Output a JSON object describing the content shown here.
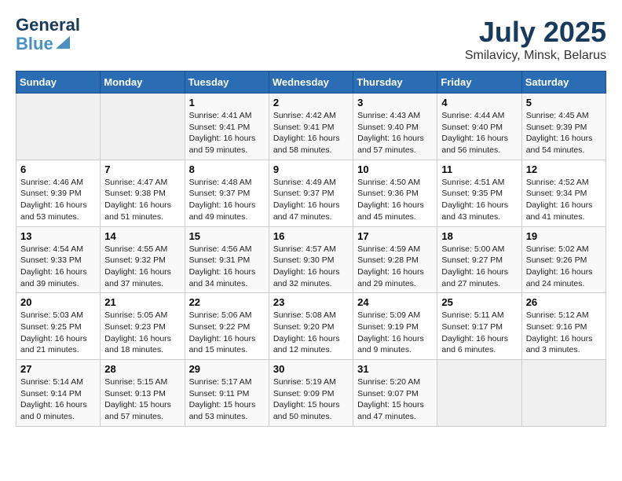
{
  "logo": {
    "line1": "General",
    "line2": "Blue"
  },
  "title": "July 2025",
  "subtitle": "Smilavicy, Minsk, Belarus",
  "weekdays": [
    "Sunday",
    "Monday",
    "Tuesday",
    "Wednesday",
    "Thursday",
    "Friday",
    "Saturday"
  ],
  "weeks": [
    [
      {
        "day": "",
        "info": ""
      },
      {
        "day": "",
        "info": ""
      },
      {
        "day": "1",
        "info": "Sunrise: 4:41 AM\nSunset: 9:41 PM\nDaylight: 16 hours and 59 minutes."
      },
      {
        "day": "2",
        "info": "Sunrise: 4:42 AM\nSunset: 9:41 PM\nDaylight: 16 hours and 58 minutes."
      },
      {
        "day": "3",
        "info": "Sunrise: 4:43 AM\nSunset: 9:40 PM\nDaylight: 16 hours and 57 minutes."
      },
      {
        "day": "4",
        "info": "Sunrise: 4:44 AM\nSunset: 9:40 PM\nDaylight: 16 hours and 56 minutes."
      },
      {
        "day": "5",
        "info": "Sunrise: 4:45 AM\nSunset: 9:39 PM\nDaylight: 16 hours and 54 minutes."
      }
    ],
    [
      {
        "day": "6",
        "info": "Sunrise: 4:46 AM\nSunset: 9:39 PM\nDaylight: 16 hours and 53 minutes."
      },
      {
        "day": "7",
        "info": "Sunrise: 4:47 AM\nSunset: 9:38 PM\nDaylight: 16 hours and 51 minutes."
      },
      {
        "day": "8",
        "info": "Sunrise: 4:48 AM\nSunset: 9:37 PM\nDaylight: 16 hours and 49 minutes."
      },
      {
        "day": "9",
        "info": "Sunrise: 4:49 AM\nSunset: 9:37 PM\nDaylight: 16 hours and 47 minutes."
      },
      {
        "day": "10",
        "info": "Sunrise: 4:50 AM\nSunset: 9:36 PM\nDaylight: 16 hours and 45 minutes."
      },
      {
        "day": "11",
        "info": "Sunrise: 4:51 AM\nSunset: 9:35 PM\nDaylight: 16 hours and 43 minutes."
      },
      {
        "day": "12",
        "info": "Sunrise: 4:52 AM\nSunset: 9:34 PM\nDaylight: 16 hours and 41 minutes."
      }
    ],
    [
      {
        "day": "13",
        "info": "Sunrise: 4:54 AM\nSunset: 9:33 PM\nDaylight: 16 hours and 39 minutes."
      },
      {
        "day": "14",
        "info": "Sunrise: 4:55 AM\nSunset: 9:32 PM\nDaylight: 16 hours and 37 minutes."
      },
      {
        "day": "15",
        "info": "Sunrise: 4:56 AM\nSunset: 9:31 PM\nDaylight: 16 hours and 34 minutes."
      },
      {
        "day": "16",
        "info": "Sunrise: 4:57 AM\nSunset: 9:30 PM\nDaylight: 16 hours and 32 minutes."
      },
      {
        "day": "17",
        "info": "Sunrise: 4:59 AM\nSunset: 9:28 PM\nDaylight: 16 hours and 29 minutes."
      },
      {
        "day": "18",
        "info": "Sunrise: 5:00 AM\nSunset: 9:27 PM\nDaylight: 16 hours and 27 minutes."
      },
      {
        "day": "19",
        "info": "Sunrise: 5:02 AM\nSunset: 9:26 PM\nDaylight: 16 hours and 24 minutes."
      }
    ],
    [
      {
        "day": "20",
        "info": "Sunrise: 5:03 AM\nSunset: 9:25 PM\nDaylight: 16 hours and 21 minutes."
      },
      {
        "day": "21",
        "info": "Sunrise: 5:05 AM\nSunset: 9:23 PM\nDaylight: 16 hours and 18 minutes."
      },
      {
        "day": "22",
        "info": "Sunrise: 5:06 AM\nSunset: 9:22 PM\nDaylight: 16 hours and 15 minutes."
      },
      {
        "day": "23",
        "info": "Sunrise: 5:08 AM\nSunset: 9:20 PM\nDaylight: 16 hours and 12 minutes."
      },
      {
        "day": "24",
        "info": "Sunrise: 5:09 AM\nSunset: 9:19 PM\nDaylight: 16 hours and 9 minutes."
      },
      {
        "day": "25",
        "info": "Sunrise: 5:11 AM\nSunset: 9:17 PM\nDaylight: 16 hours and 6 minutes."
      },
      {
        "day": "26",
        "info": "Sunrise: 5:12 AM\nSunset: 9:16 PM\nDaylight: 16 hours and 3 minutes."
      }
    ],
    [
      {
        "day": "27",
        "info": "Sunrise: 5:14 AM\nSunset: 9:14 PM\nDaylight: 16 hours and 0 minutes."
      },
      {
        "day": "28",
        "info": "Sunrise: 5:15 AM\nSunset: 9:13 PM\nDaylight: 15 hours and 57 minutes."
      },
      {
        "day": "29",
        "info": "Sunrise: 5:17 AM\nSunset: 9:11 PM\nDaylight: 15 hours and 53 minutes."
      },
      {
        "day": "30",
        "info": "Sunrise: 5:19 AM\nSunset: 9:09 PM\nDaylight: 15 hours and 50 minutes."
      },
      {
        "day": "31",
        "info": "Sunrise: 5:20 AM\nSunset: 9:07 PM\nDaylight: 15 hours and 47 minutes."
      },
      {
        "day": "",
        "info": ""
      },
      {
        "day": "",
        "info": ""
      }
    ]
  ]
}
